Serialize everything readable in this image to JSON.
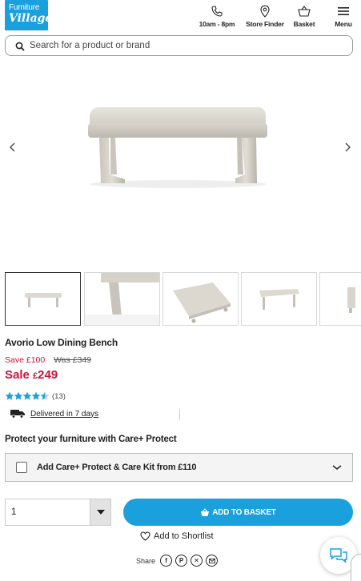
{
  "header": {
    "logo_line1": "Furniture",
    "logo_line2": "Village",
    "phone_label": "10am - 8pm",
    "store_label": "Store Finder",
    "basket_label": "Basket",
    "menu_label": "Menu"
  },
  "search": {
    "placeholder": "Search for a product or brand",
    "value": ""
  },
  "gallery": {
    "icons": [
      "chevron-left-icon",
      "chevron-right-icon"
    ],
    "thumbnail_count": 5,
    "active_index": 0
  },
  "product": {
    "title": "Avorio Low Dining Bench",
    "save_text": "Save £100",
    "was_text": "Was £349",
    "sale_label": "Sale",
    "sale_currency": "£",
    "sale_amount": "249",
    "rating_value": 4.5,
    "rating_max": 5,
    "review_count": "(13)",
    "delivery_text": "Delivered in 7 days"
  },
  "protect": {
    "heading": "Protect your furniture with Care+ Protect",
    "option_label": "Add Care+ Protect & Care Kit from £110",
    "checked": false
  },
  "purchase": {
    "quantity": "1",
    "add_to_basket": "ADD TO BASKET",
    "shortlist": "Add to Shortlist",
    "share_label": "Share",
    "share_icons": [
      "facebook-icon",
      "pinterest-icon",
      "x-icon",
      "email-icon"
    ]
  },
  "colors": {
    "brand_blue": "#1aa0dc",
    "sale_red": "#d0103a",
    "star_blue": "#1aa0dc"
  }
}
